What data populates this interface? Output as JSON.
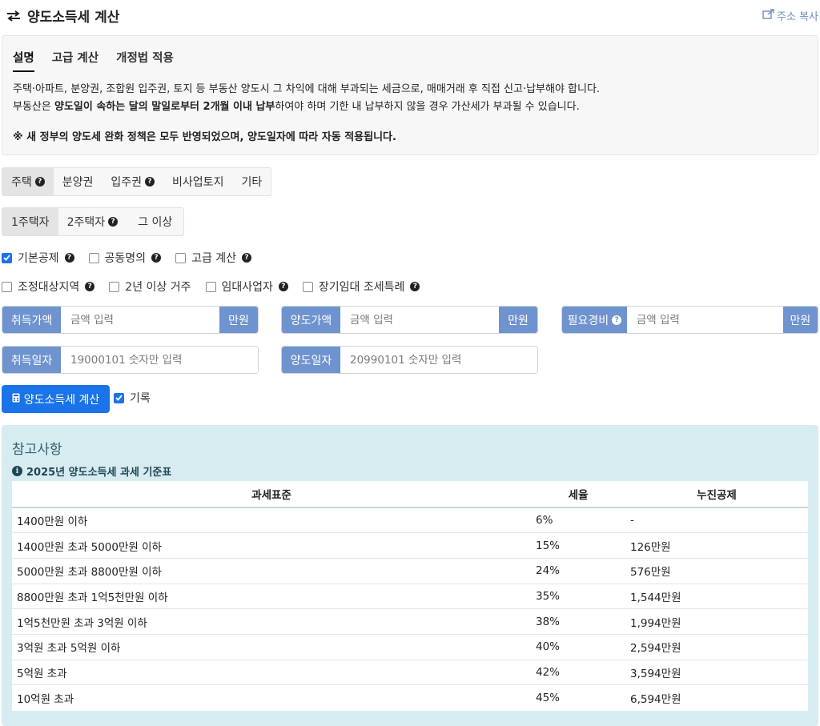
{
  "header": {
    "title": "양도소득세 계산",
    "copy_label": "주소 복사"
  },
  "desc": {
    "tabs": [
      "설명",
      "고급 계산",
      "개정법 적용"
    ],
    "line1": "주택·아파트, 분양권, 조합원 입주권, 토지 등 부동산 양도시 그 차익에 대해 부과되는 세금으로, 매매거래 후 직접 신고·납부해야 합니다.",
    "line2_pre": "부동산은 ",
    "line2_bold": "양도일이 속하는 달의 말일로부터 2개월 이내 납부",
    "line2_post": "하여야 하며 기한 내 납부하지 않을 경우 가산세가 부과될 수 있습니다.",
    "note": "※ 새 정부의 양도세 완화 정책은 모두 반영되었으며, 양도일자에 따라 자동 적용됩니다."
  },
  "asset_types": [
    "주택",
    "분양권",
    "입주권",
    "비사업토지",
    "기타"
  ],
  "owner_types": [
    "1주택자",
    "2주택자",
    "그 이상"
  ],
  "options_row1": [
    {
      "label": "기본공제",
      "checked": true
    },
    {
      "label": "공동명의",
      "checked": false
    },
    {
      "label": "고급 계산",
      "checked": false
    }
  ],
  "options_row2": [
    {
      "label": "조정대상지역",
      "checked": false
    },
    {
      "label": "2년 이상 거주",
      "checked": false
    },
    {
      "label": "임대사업자",
      "checked": false
    },
    {
      "label": "장기임대 조세특례",
      "checked": false
    }
  ],
  "fields": {
    "acq_price": {
      "label": "취득가액",
      "placeholder": "금액 입력",
      "unit": "만원"
    },
    "sale_price": {
      "label": "양도가액",
      "placeholder": "금액 입력",
      "unit": "만원"
    },
    "expense": {
      "label": "필요경비",
      "placeholder": "금액 입력",
      "unit": "만원"
    },
    "acq_date": {
      "label": "취득일자",
      "placeholder": "19000101 숫자만 입력"
    },
    "sale_date": {
      "label": "양도일자",
      "placeholder": "20990101 숫자만 입력"
    }
  },
  "calc_button": "양도소득세 계산",
  "record_label": "기록",
  "reference": {
    "title": "참고사항",
    "subtitle": "2025년 양도소득세 과세 기준표",
    "headers": [
      "과세표준",
      "세율",
      "누진공제"
    ],
    "rows": [
      [
        "1400만원 이하",
        "6%",
        "-"
      ],
      [
        "1400만원 초과 5000만원 이하",
        "15%",
        "126만원"
      ],
      [
        "5000만원 초과 8800만원 이하",
        "24%",
        "576만원"
      ],
      [
        "8800만원 초과 1억5천만원 이하",
        "35%",
        "1,544만원"
      ],
      [
        "1억5천만원 초과 3억원 이하",
        "38%",
        "1,994만원"
      ],
      [
        "3억원 초과 5억원 이하",
        "40%",
        "2,594만원"
      ],
      [
        "5억원 초과",
        "42%",
        "3,594만원"
      ],
      [
        "10억원 초과",
        "45%",
        "6,594만원"
      ]
    ]
  }
}
